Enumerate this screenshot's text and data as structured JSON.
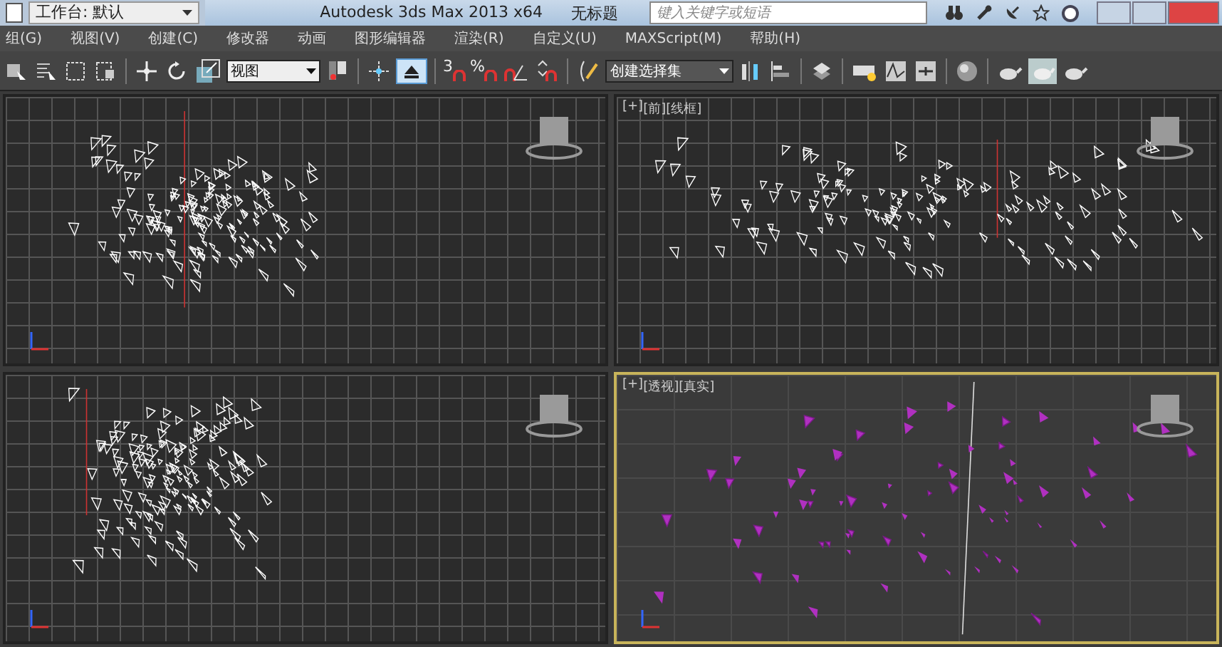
{
  "title_bar": {
    "workspace": "工作台: 默认",
    "title": "Autodesk 3ds Max  2013 x64",
    "document": "无标题",
    "search": {
      "placeholder": "键入关键字或短语"
    }
  },
  "menu": [
    {
      "label": "组(G)"
    },
    {
      "label": "视图(V)"
    },
    {
      "label": "创建(C)"
    },
    {
      "label": "修改器"
    },
    {
      "label": "动画"
    },
    {
      "label": "图形编辑器"
    },
    {
      "label": "渲染(R)"
    },
    {
      "label": "自定义(U)"
    },
    {
      "label": "MAXScript(M)"
    },
    {
      "label": "帮助(H)"
    }
  ],
  "toolbar": {
    "reference_dropdown": "视图",
    "selection_set_dropdown": "创建选择集",
    "snap_buttons": [
      {
        "glyph": "3"
      },
      {
        "glyph": "%"
      }
    ],
    "pivot_button": {
      "selected": true
    }
  },
  "viewports": [
    {
      "kind": "wireframe",
      "active": false
    },
    {
      "labels": [
        "[+]",
        "[前]",
        "[线框]"
      ],
      "kind": "wireframe",
      "active": false
    },
    {
      "kind": "wireframe",
      "active": false
    },
    {
      "labels": [
        "[+]",
        "[透视]",
        "[真实]"
      ],
      "kind": "shaded",
      "active": true
    }
  ]
}
